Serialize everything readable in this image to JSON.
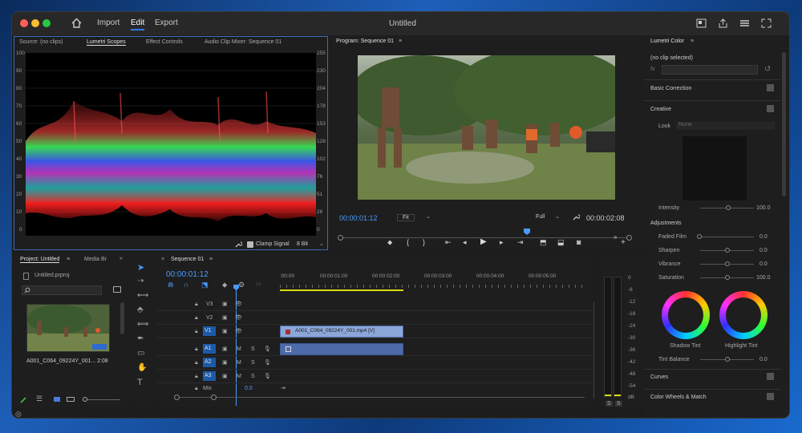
{
  "menu": {
    "import": "Import",
    "edit": "Edit",
    "export": "Export",
    "title": "Untitled"
  },
  "source_panel": {
    "tabs": [
      "Source: (no clips)",
      "Lumetri Scopes",
      "Effect Controls",
      "Audio Clip Mixer: Sequence 01"
    ],
    "left_scale": [
      "100",
      "90",
      "80",
      "70",
      "60",
      "50",
      "40",
      "30",
      "20",
      "10",
      "0"
    ],
    "right_scale": [
      "255",
      "230",
      "204",
      "178",
      "153",
      "128",
      "102",
      "76",
      "51",
      "26",
      "0"
    ],
    "clamp_label": "Clamp Signal",
    "bit_label": "8 Bit"
  },
  "program": {
    "title": "Program: Sequence 01",
    "timecode": "00:00:01:12",
    "fit": "Fit",
    "full": "Full",
    "duration": "00:00:02:08"
  },
  "lumetri": {
    "title": "Lumetri Color",
    "clip": "(no clip selected)",
    "fx": "fx",
    "basic": "Basic Correction",
    "creative": "Creative",
    "look": "Look",
    "look_value": "None",
    "intensity": "Intensity",
    "intensity_value": "100.0",
    "adjustments": "Adjustments",
    "sliders": [
      {
        "label": "Faded Film",
        "value": "0.0"
      },
      {
        "label": "Sharpen",
        "value": "0.0"
      },
      {
        "label": "Vibrance",
        "value": "0.0"
      },
      {
        "label": "Saturation",
        "value": "100.0"
      }
    ],
    "shadow_tint": "Shadow Tint",
    "highlight_tint": "Highlight Tint",
    "tint_balance": "Tint Balance",
    "tint_balance_value": "0.0",
    "curves": "Curves",
    "wheels": "Color Wheels & Match"
  },
  "project": {
    "tabs": [
      "Project: Untitled",
      "Media Br"
    ],
    "file": "Untitled.prproj",
    "clip_name": "A001_C064_09224Y_001...",
    "clip_duration": "2:08"
  },
  "timeline": {
    "tab": "Sequence 01",
    "timecode": "00:00:01:12",
    "ruler": [
      ":00:00",
      "00:00:01:00",
      "00:00:02:00",
      "00:00:03:00",
      "00:00:04:00",
      "00:00:05:00"
    ],
    "video_tracks": [
      "V3",
      "V2",
      "V1"
    ],
    "audio_tracks": [
      "A1",
      "A2",
      "A3"
    ],
    "mix": "Mix",
    "mix_value": "0.0",
    "clip_label": "A001_C064_09224Y_001.mp4 [V]",
    "m": "M",
    "s": "S"
  },
  "meter": {
    "scale": [
      "0",
      "-6",
      "-12",
      "-18",
      "-24",
      "-30",
      "-36",
      "-42",
      "-48",
      "-54",
      "dB"
    ],
    "s": "S"
  }
}
